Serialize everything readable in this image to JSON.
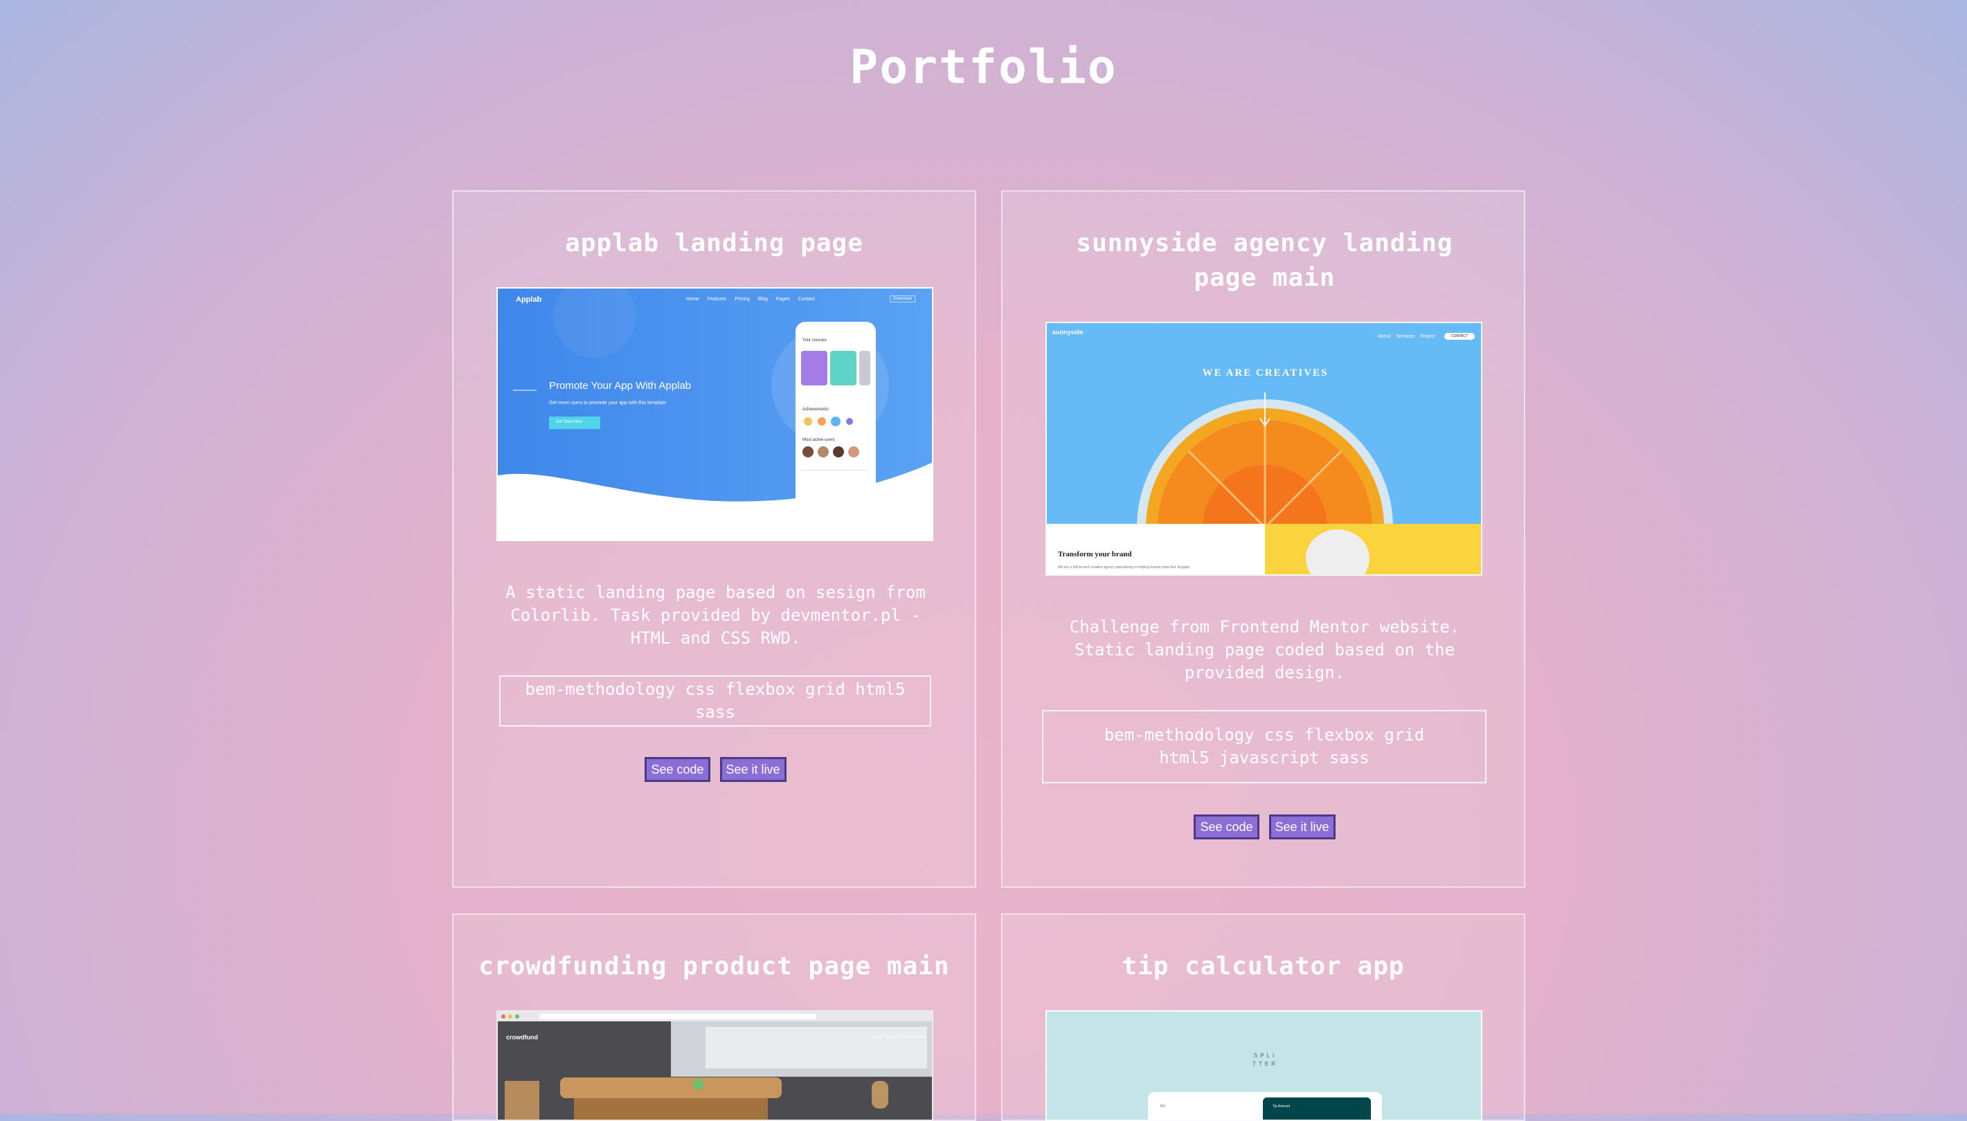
{
  "page": {
    "title": "Portfolio"
  },
  "colors": {
    "button_bg": "#8b6fd6",
    "button_border": "#4a3a84"
  },
  "projects": [
    {
      "title": "applab landing page",
      "description": "A static landing page based on sesign from Colorlib. Task provided by devmentor.pl - HTML and CSS RWD.",
      "tags": "bem-methodology css flexbox grid html5 sass",
      "see_code": "See code",
      "see_live": "See it live",
      "thumb": {
        "logo": "Applab",
        "nav": [
          "Home",
          "Features",
          "Pricing",
          "Blog",
          "Pages",
          "Contact"
        ],
        "cta": "Download",
        "headline": "Promote Your App With Applab",
        "sub": "Get more users to promote your app with this template",
        "button": "Get Start Now",
        "phone_heading": "Your courses",
        "phone_section1": "Achievements",
        "phone_section2": "Most active users"
      }
    },
    {
      "title": "sunnyside agency landing page main",
      "description": "Challenge from Frontend Mentor website. Static landing page coded based on the provided design.",
      "tags": "bem-methodology css flexbox grid html5 javascript sass",
      "see_code": "See code",
      "see_live": "See it live",
      "thumb": {
        "logo": "sunnyside",
        "nav": [
          "About",
          "Services",
          "Project"
        ],
        "cta": "CONTACT",
        "headline": "WE ARE CREATIVES",
        "section_title": "Transform your brand",
        "section_text": "We are a full-service creative agency specializing in helping brands grow fast. Engage"
      }
    },
    {
      "title": "crowdfunding product page main",
      "thumb": {
        "logo": "crowdfund",
        "nav": "About  Discover  Get Started"
      }
    },
    {
      "title": "tip calculator app",
      "thumb": {
        "logo": "SPLI\nTTER",
        "label": "Bill",
        "panel": "Tip Amount"
      }
    }
  ]
}
